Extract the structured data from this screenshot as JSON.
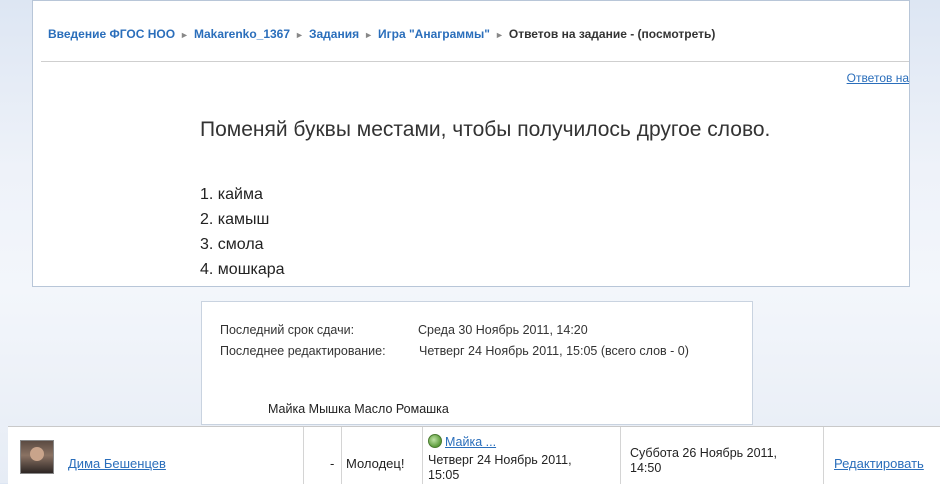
{
  "breadcrumb": {
    "items": [
      "Введение ФГОС НОО",
      "Makarenko_1367",
      "Задания",
      "Игра \"Анаграммы\""
    ],
    "current": "Ответов на задание - (посмотреть)",
    "separator": "►"
  },
  "header_link": "Ответов на",
  "task": {
    "headline": "Поменяй буквы местами, чтобы получилось другое слово.",
    "words": [
      "1. кайма",
      "2. камыш",
      "3. смола",
      "4. мошкара"
    ]
  },
  "submission_info": {
    "due_label": "Последний срок сдачи:",
    "due_value": "Среда 30 Ноябрь 2011, 14:20",
    "edited_label": "Последнее редактирование:",
    "edited_value": "Четверг 24 Ноябрь 2011, 15:05 (всего слов - 0)",
    "answer_text": "Майка Мышка Масло Ромашка"
  },
  "submission_row": {
    "student_name": "Дима Бешенцев",
    "grade": "-",
    "comment": "Молодец!",
    "file_link": "Майка ...",
    "file_date_line1": "Четверг 24 Ноябрь 2011,",
    "file_date_line2": "15:05",
    "graded_date_line1": "Суббота 26 Ноябрь 2011,",
    "graded_date_line2": "14:50",
    "action": "Редактировать"
  },
  "colors": {
    "link": "#2a6ebb",
    "text": "#333333",
    "background": "#e6ecf5"
  },
  "icons": {
    "file": "document-icon",
    "separator": "triangle-right-icon"
  }
}
